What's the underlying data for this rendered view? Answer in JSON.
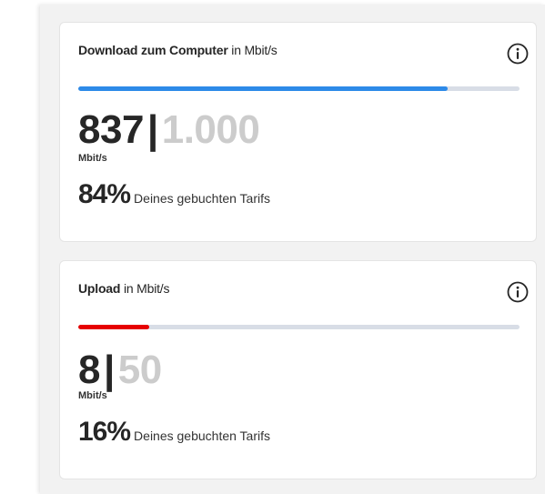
{
  "colors": {
    "download_bar": "#2d8ae8",
    "upload_bar": "#e60000",
    "track": "#d8dde6",
    "max_value": "#cccccc"
  },
  "download": {
    "title_bold": "Download zum Computer",
    "title_light": "in Mbit/s",
    "info_icon": "info-circle-icon",
    "current": "837",
    "separator": "|",
    "max": "1.000",
    "unit": "Mbit/s",
    "percent": "84%",
    "percent_label": "Deines gebuchten Tarifs",
    "progress_fraction": 0.837
  },
  "upload": {
    "title_bold": "Upload",
    "title_light": "in Mbit/s",
    "info_icon": "info-circle-icon",
    "current": "8",
    "separator": "|",
    "max": "50",
    "unit": "Mbit/s",
    "percent": "16%",
    "percent_label": "Deines gebuchten Tarifs",
    "progress_fraction": 0.16
  }
}
